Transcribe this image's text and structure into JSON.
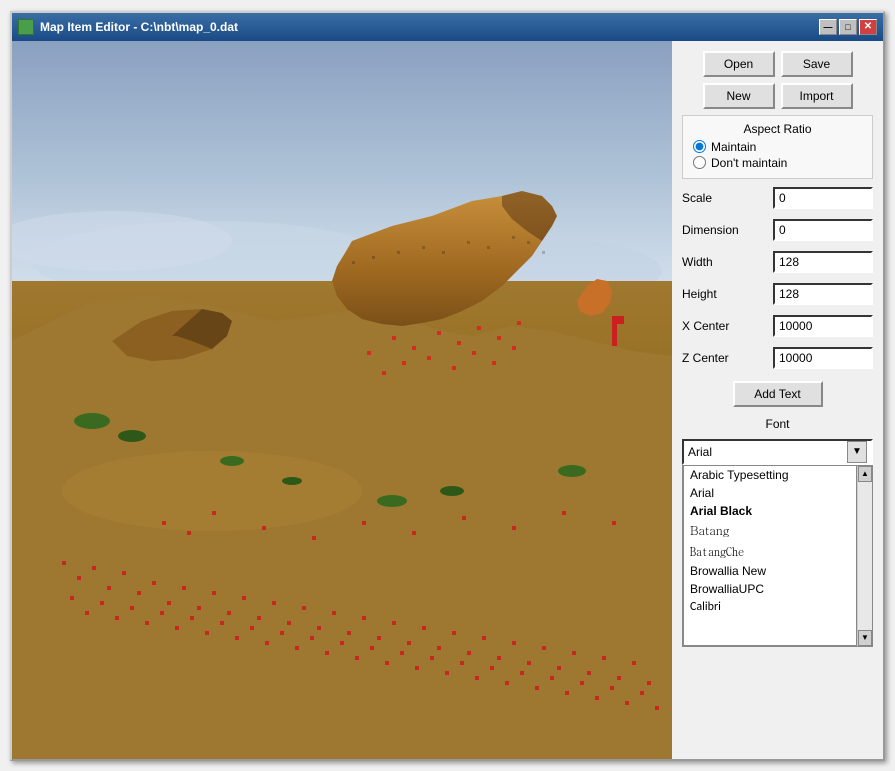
{
  "window": {
    "title": "Map Item Editor - C:\\nbt\\map_0.dat",
    "icon": "map-icon"
  },
  "title_buttons": {
    "minimize": "—",
    "maximize": "□",
    "close": "✕"
  },
  "toolbar": {
    "open_label": "Open",
    "save_label": "Save",
    "new_label": "New",
    "import_label": "Import"
  },
  "aspect_ratio": {
    "title": "Aspect Ratio",
    "option_maintain": "Maintain",
    "option_dont_maintain": "Don't maintain",
    "selected": "maintain"
  },
  "fields": {
    "scale": {
      "label": "Scale",
      "value": "0"
    },
    "dimension": {
      "label": "Dimension",
      "value": "0"
    },
    "width": {
      "label": "Width",
      "value": "128"
    },
    "height": {
      "label": "Height",
      "value": "128"
    },
    "x_center": {
      "label": "X Center",
      "value": "10000"
    },
    "z_center": {
      "label": "Z Center",
      "value": "10000"
    }
  },
  "add_text_btn": "Add Text",
  "font_section": {
    "label": "Font",
    "selected": "Arial",
    "list": [
      {
        "name": "Arabic Typesetting",
        "style": "normal"
      },
      {
        "name": "Arial",
        "style": "normal"
      },
      {
        "name": "Arial Black",
        "style": "bold"
      },
      {
        "name": "Batang",
        "style": "normal"
      },
      {
        "name": "BatangChe",
        "style": "normal"
      },
      {
        "name": "Browallia New",
        "style": "normal"
      },
      {
        "name": "BrowalliaUPC",
        "style": "normal"
      },
      {
        "name": "Calibri",
        "style": "normal"
      }
    ]
  },
  "colors": {
    "sky_top": "#8aa0c0",
    "sky_bottom": "#d8e4ee",
    "ground": "#8B6914",
    "accent_blue": "#3a6ea5",
    "window_border": "#999999"
  }
}
